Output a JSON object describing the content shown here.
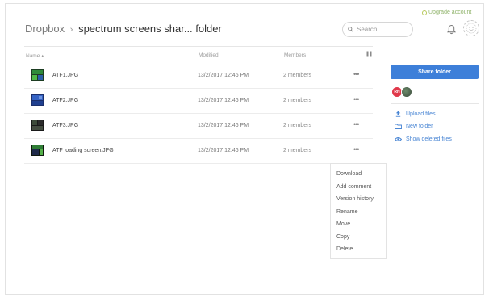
{
  "header": {
    "upgrade_link": "Upgrade account",
    "breadcrumb_root": "Dropbox",
    "breadcrumb_separator": "›",
    "breadcrumb_current": "spectrum screens shar... folder",
    "search_placeholder": "Search"
  },
  "table": {
    "columns": {
      "name": "Name ▴",
      "modified": "Modified",
      "members": "Members"
    },
    "rows": [
      {
        "name": "ATF1.JPG",
        "modified": "13/2/2017 12:46 PM",
        "members": "2 members",
        "more": "•••",
        "thumb": "green-blue-image"
      },
      {
        "name": "ATF2.JPG",
        "modified": "13/2/2017 12:46 PM",
        "members": "2 members",
        "more": "•••",
        "thumb": "blue-image"
      },
      {
        "name": "ATF3.JPG",
        "modified": "13/2/2017 12:46 PM",
        "members": "2 members",
        "more": "•••",
        "thumb": "dark-image"
      },
      {
        "name": "ATF loading screen.JPG",
        "modified": "13/2/2017 12:46 PM",
        "members": "2 members",
        "more": "•••",
        "thumb": "green-dark-image"
      }
    ]
  },
  "context_menu": {
    "items": [
      "Download",
      "Add comment",
      "Version history",
      "Rename",
      "Move",
      "Copy",
      "Delete"
    ]
  },
  "sidebar": {
    "share_button": "Share folder",
    "member_initials": "RH",
    "links": {
      "upload": "Upload files",
      "new_folder": "New folder",
      "show_deleted": "Show deleted files"
    }
  },
  "colors": {
    "accent": "#3d7fd9",
    "link": "#4a86d4",
    "upgrade": "#8fb36a",
    "member_badge": "#e0384a"
  }
}
